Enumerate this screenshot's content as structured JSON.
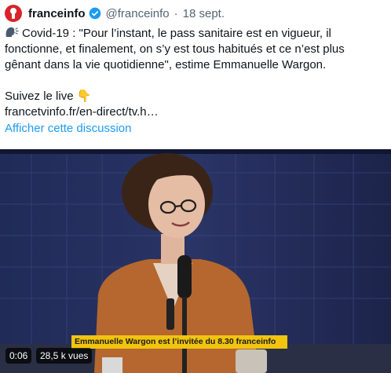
{
  "tweet": {
    "author_name": "franceinfo",
    "handle": "@franceinfo",
    "separator": "·",
    "date": "18 sept.",
    "text_lines": [
      "Covid-19 : \"Pour l’instant, le pass sanitaire est en vigueur, il",
      "fonctionne, et finalement, on s’y est tous habitués et ce n’est plus",
      "gênant dans la vie quotidienne\", estime Emmanuelle Wargon."
    ],
    "follow_text": "Suivez le live 👇",
    "link": "francetvinfo.fr/en-direct/tv.h…",
    "show_thread": "Afficher cette discussion"
  },
  "video": {
    "banner_text": "Emmanuelle Wargon est l’invitée du 8.30 franceinfo",
    "duration": "0:06",
    "views": "28,5 k vues"
  },
  "colors": {
    "link_blue": "#1d9bf0",
    "brand_red": "#d8232a",
    "banner_yellow": "#f1c40f"
  }
}
